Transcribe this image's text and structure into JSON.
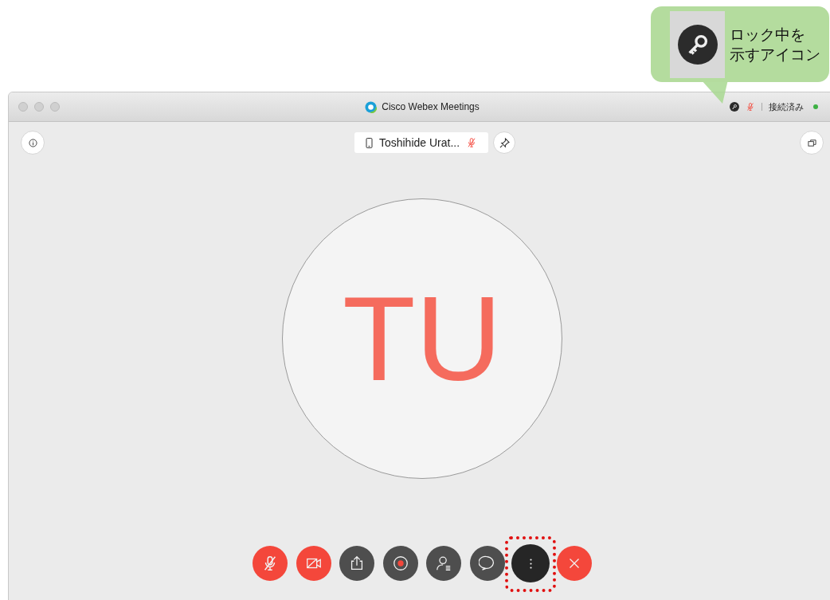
{
  "annotation": {
    "lines": [
      "ロック中を",
      "示すアイコン"
    ]
  },
  "window": {
    "title": "Cisco Webex Meetings",
    "locked": true,
    "muted": true,
    "status": "接続済み",
    "connected": true
  },
  "participant": {
    "name": "Toshihide Urat...",
    "muted": true,
    "initials": "TU"
  },
  "controls": [
    {
      "kind": "mic",
      "highlighted": false
    },
    {
      "kind": "video",
      "highlighted": false
    },
    {
      "kind": "share",
      "highlighted": false
    },
    {
      "kind": "record",
      "highlighted": false
    },
    {
      "kind": "participants",
      "highlighted": false
    },
    {
      "kind": "chat",
      "highlighted": false
    },
    {
      "kind": "more",
      "highlighted": true
    },
    {
      "kind": "end",
      "highlighted": false
    }
  ]
}
